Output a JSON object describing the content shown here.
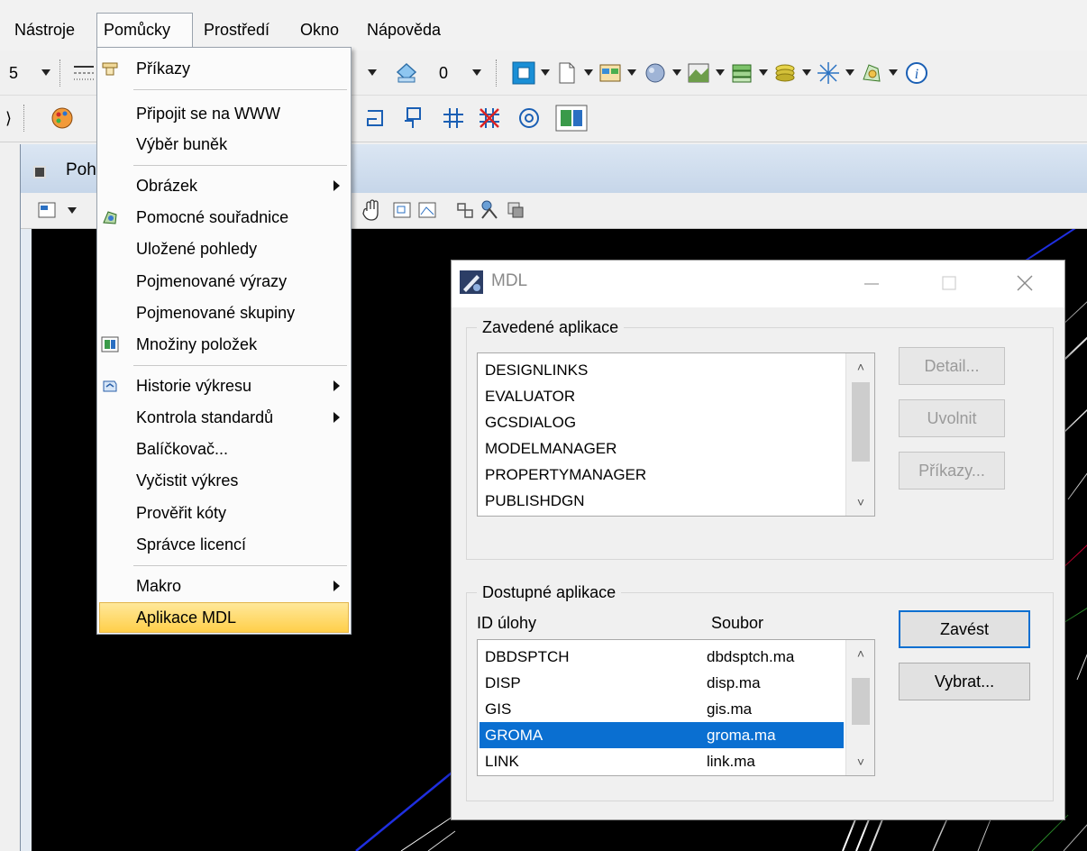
{
  "menubar": {
    "items": [
      {
        "label": "Nástroje"
      },
      {
        "label": "Pomůcky"
      },
      {
        "label": "Prostředí"
      },
      {
        "label": "Okno"
      },
      {
        "label": "Nápověda"
      }
    ]
  },
  "toolbar1": {
    "level_value": "5",
    "display_value": "0"
  },
  "view": {
    "title": "Poh"
  },
  "dropdown": {
    "items": [
      {
        "label": "Příkazy"
      },
      {
        "label": "Připojit se na WWW"
      },
      {
        "label": "Výběr buněk"
      },
      {
        "label": "Obrázek"
      },
      {
        "label": "Pomocné souřadnice"
      },
      {
        "label": "Uložené pohledy"
      },
      {
        "label": "Pojmenované výrazy"
      },
      {
        "label": "Pojmenované skupiny"
      },
      {
        "label": "Množiny položek"
      },
      {
        "label": "Historie výkresu"
      },
      {
        "label": "Kontrola standardů"
      },
      {
        "label": "Balíčkovač..."
      },
      {
        "label": "Vyčistit výkres"
      },
      {
        "label": "Prověřit kóty"
      },
      {
        "label": "Správce licencí"
      },
      {
        "label": "Makro"
      },
      {
        "label": "Aplikace MDL"
      }
    ]
  },
  "mdl": {
    "title": "MDL",
    "loaded": {
      "group_label": "Zavedené aplikace",
      "items": [
        "DESIGNLINKS",
        "EVALUATOR",
        "GCSDIALOG",
        "MODELMANAGER",
        "PROPERTYMANAGER",
        "PUBLISHDGN"
      ],
      "buttons": {
        "detail": "Detail...",
        "unload": "Uvolnit",
        "commands": "Příkazy..."
      }
    },
    "available": {
      "group_label": "Dostupné aplikace",
      "col_id": "ID úlohy",
      "col_file": "Soubor",
      "rows": [
        {
          "id": "DBDSPTCH",
          "file": "dbdsptch.ma"
        },
        {
          "id": "DISP",
          "file": "disp.ma"
        },
        {
          "id": "GIS",
          "file": "gis.ma"
        },
        {
          "id": "GROMA",
          "file": "groma.ma"
        },
        {
          "id": "LINK",
          "file": "link.ma"
        }
      ],
      "selected_id": "GROMA",
      "buttons": {
        "load": "Zavést",
        "browse": "Vybrat..."
      }
    }
  },
  "colors": {
    "selection": "#0a6fd1",
    "menu_highlight": "#ffd966",
    "canvas": "#000000"
  }
}
